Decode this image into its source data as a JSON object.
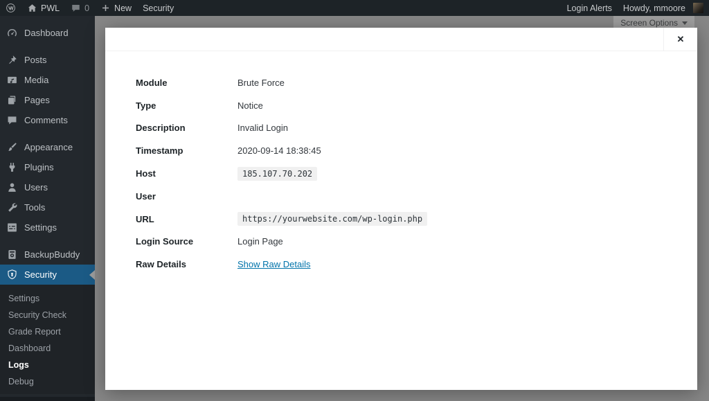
{
  "colors": {
    "accent_blue": "#1b5a85",
    "link_blue": "#0073aa",
    "adminbar_bg": "#1d2327",
    "sidebar_bg": "#23282d",
    "overlay_gray": "#878787",
    "code_chip_bg": "#f0f0f0"
  },
  "admin_bar": {
    "site_name": "PWL",
    "comment_count": "0",
    "new_label": "New",
    "page_label": "Security",
    "login_alerts_label": "Login Alerts",
    "howdy_label": "Howdy, mmoore"
  },
  "screen_options": {
    "label": "Screen Options"
  },
  "sidebar": {
    "items": [
      {
        "icon": "dashboard-icon",
        "label": "Dashboard"
      },
      {
        "separator": true
      },
      {
        "icon": "pin-icon",
        "label": "Posts"
      },
      {
        "icon": "media-icon",
        "label": "Media"
      },
      {
        "icon": "pages-icon",
        "label": "Pages"
      },
      {
        "icon": "comments-icon",
        "label": "Comments"
      },
      {
        "separator": true
      },
      {
        "icon": "appearance-icon",
        "label": "Appearance"
      },
      {
        "icon": "plugins-icon",
        "label": "Plugins"
      },
      {
        "icon": "users-icon",
        "label": "Users"
      },
      {
        "icon": "tools-icon",
        "label": "Tools"
      },
      {
        "icon": "settings-icon",
        "label": "Settings"
      },
      {
        "separator": true
      },
      {
        "icon": "backupbuddy-icon",
        "label": "BackupBuddy"
      },
      {
        "icon": "shield-icon",
        "label": "Security",
        "active": true,
        "submenu": [
          {
            "label": "Settings"
          },
          {
            "label": "Security Check"
          },
          {
            "label": "Grade Report"
          },
          {
            "label": "Dashboard"
          },
          {
            "label": "Logs",
            "current": true
          },
          {
            "label": "Debug"
          }
        ]
      }
    ]
  },
  "modal": {
    "close_label": "✕",
    "rows": [
      {
        "label": "Module",
        "value": "Brute Force",
        "type": "text"
      },
      {
        "label": "Type",
        "value": "Notice",
        "type": "text"
      },
      {
        "label": "Description",
        "value": "Invalid Login",
        "type": "text"
      },
      {
        "label": "Timestamp",
        "value": "2020-09-14 18:38:45",
        "type": "text"
      },
      {
        "label": "Host",
        "value": "185.107.70.202",
        "type": "code"
      },
      {
        "label": "User",
        "value": "",
        "type": "empty"
      },
      {
        "label": "URL",
        "value": "https://yourwebsite.com/wp-login.php",
        "type": "code"
      },
      {
        "label": "Login Source",
        "value": "Login Page",
        "type": "text"
      },
      {
        "label": "Raw Details",
        "value": "Show Raw Details",
        "type": "link"
      }
    ]
  }
}
